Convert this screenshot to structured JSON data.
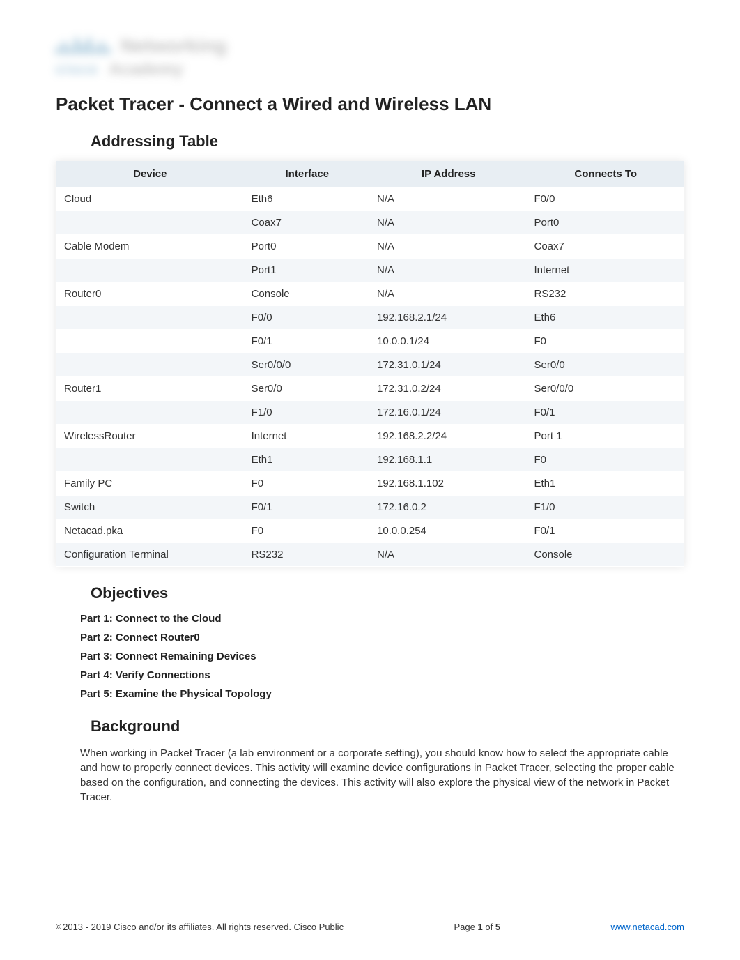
{
  "logo": {
    "text_top": "Networking",
    "text_bottom": "Academy"
  },
  "title": "Packet Tracer - Connect a Wired and Wireless LAN",
  "sections": {
    "addressing": "Addressing Table",
    "objectives": "Objectives",
    "background": "Background"
  },
  "table": {
    "headers": {
      "device": "Device",
      "interface": "Interface",
      "ip": "IP Address",
      "connects": "Connects To"
    },
    "rows": [
      {
        "device": "Cloud",
        "interface": "Eth6",
        "ip": "N/A",
        "connects": "F0/0"
      },
      {
        "device": "",
        "interface": "Coax7",
        "ip": "N/A",
        "connects": "Port0"
      },
      {
        "device": "Cable Modem",
        "interface": "Port0",
        "ip": "N/A",
        "connects": "Coax7"
      },
      {
        "device": "",
        "interface": "Port1",
        "ip": "N/A",
        "connects": "Internet"
      },
      {
        "device": "Router0",
        "interface": "Console",
        "ip": "N/A",
        "connects": "RS232"
      },
      {
        "device": "",
        "interface": "F0/0",
        "ip": "192.168.2.1/24",
        "connects": "Eth6"
      },
      {
        "device": "",
        "interface": "F0/1",
        "ip": "10.0.0.1/24",
        "connects": "F0"
      },
      {
        "device": "",
        "interface": "Ser0/0/0",
        "ip": "172.31.0.1/24",
        "connects": "Ser0/0"
      },
      {
        "device": "Router1",
        "interface": "Ser0/0",
        "ip": "172.31.0.2/24",
        "connects": "Ser0/0/0"
      },
      {
        "device": "",
        "interface": "F1/0",
        "ip": "172.16.0.1/24",
        "connects": "F0/1"
      },
      {
        "device": "WirelessRouter",
        "interface": "Internet",
        "ip": "192.168.2.2/24",
        "connects": "Port 1"
      },
      {
        "device": "",
        "interface": "Eth1",
        "ip": "192.168.1.1",
        "connects": "F0"
      },
      {
        "device": "Family PC",
        "interface": "F0",
        "ip": "192.168.1.102",
        "connects": "Eth1"
      },
      {
        "device": "Switch",
        "interface": "F0/1",
        "ip": "172.16.0.2",
        "connects": "F1/0"
      },
      {
        "device": "Netacad.pka",
        "interface": "F0",
        "ip": "10.0.0.254",
        "connects": "F0/1"
      },
      {
        "device": "Configuration Terminal",
        "interface": "RS232",
        "ip": "N/A",
        "connects": "Console"
      }
    ]
  },
  "objectives": [
    "Part 1: Connect to the Cloud",
    "Part 2: Connect Router0",
    "Part 3: Connect Remaining Devices",
    "Part 4: Verify Connections",
    "Part 5: Examine the Physical Topology"
  ],
  "background_text": "When working in Packet Tracer (a lab environment or a corporate setting), you should know how to select the appropriate cable and how to properly connect devices. This activity will examine device configurations in Packet Tracer, selecting the proper cable based on the configuration, and connecting the devices. This activity will also explore the physical view of the network in Packet Tracer.",
  "footer": {
    "copyright": "2013 - 2019 Cisco and/or its affiliates. All rights reserved. Cisco Public",
    "page_prefix": "Page ",
    "page_num": "1",
    "page_sep": " of ",
    "page_total": "5",
    "url": "www.netacad.com"
  }
}
